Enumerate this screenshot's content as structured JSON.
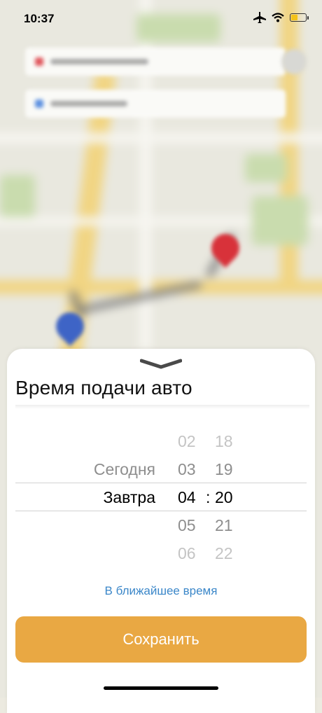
{
  "status_bar": {
    "time": "10:37",
    "icons": [
      "airplane-icon",
      "wifi-icon",
      "battery-icon"
    ],
    "battery_color": "#f3c21a"
  },
  "sheet": {
    "title": "Время подачи авто",
    "picker": {
      "day_rows": [
        "Сегодня",
        "Завтра"
      ],
      "selected_day": "Завтра",
      "hour_rows": [
        "02",
        "03",
        "04",
        "05",
        "06"
      ],
      "minute_rows": [
        "18",
        "19",
        "20",
        "21",
        "22"
      ],
      "selected_hour": "04",
      "selected_minute": "20",
      "separator": ":"
    },
    "asap_link": "В ближайшее время",
    "save_label": "Сохранить"
  },
  "colors": {
    "accent_button": "#e9a843",
    "link": "#3b87c9",
    "pin_destination": "#d8323a",
    "pin_origin": "#3e64c6"
  }
}
